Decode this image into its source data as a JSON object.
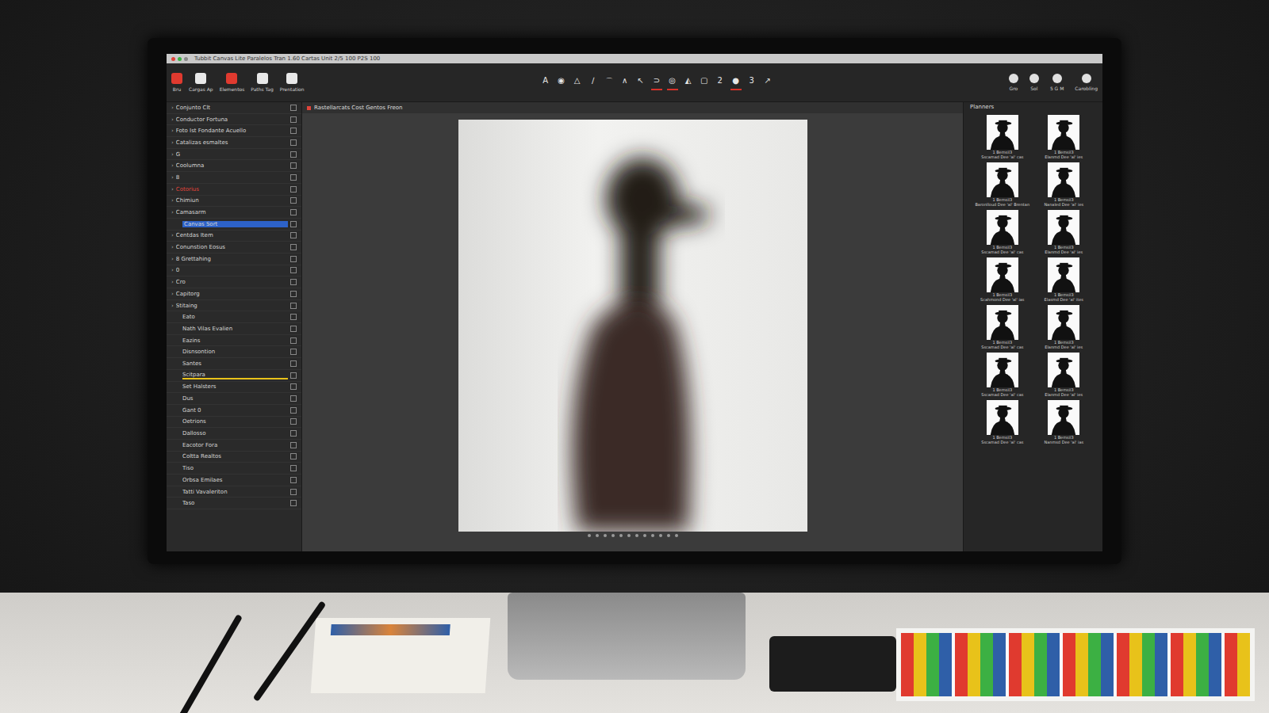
{
  "window": {
    "title": "Tubbit Canvas Lite  Paralelos  Tran  1.60  Cartas Unit  2/5  100  P2S  100"
  },
  "app_toolbar": [
    {
      "label": "Bru"
    },
    {
      "label": "Cargas Ap"
    },
    {
      "label": "Elementos"
    },
    {
      "label": "Paths Tag"
    },
    {
      "label": "Prentation"
    }
  ],
  "tools": [
    {
      "glyph": "A",
      "selected": false
    },
    {
      "glyph": "◉",
      "selected": false
    },
    {
      "glyph": "△",
      "selected": false
    },
    {
      "glyph": "∕",
      "selected": false
    },
    {
      "glyph": "⌒",
      "selected": false
    },
    {
      "glyph": "∧",
      "selected": false
    },
    {
      "glyph": "↖",
      "selected": false
    },
    {
      "glyph": "⊃",
      "selected": true
    },
    {
      "glyph": "◎",
      "selected": true
    },
    {
      "glyph": "◭",
      "selected": false
    },
    {
      "glyph": "▢",
      "selected": false
    },
    {
      "glyph": "2",
      "selected": false
    },
    {
      "glyph": "●",
      "selected": true
    },
    {
      "glyph": "3",
      "selected": false
    },
    {
      "glyph": "↗",
      "selected": false
    }
  ],
  "right_tools": [
    {
      "label": "Gro"
    },
    {
      "label": "Sol"
    },
    {
      "label": "5 G M"
    },
    {
      "label": "Carobling"
    }
  ],
  "document_tab": "Rastellarcats  Cost Gentos  Freon",
  "panel_title": "Planners",
  "layers": [
    {
      "kind": "group",
      "toggle": "›",
      "label": "Conjunto Clt",
      "selected": false,
      "alert": false
    },
    {
      "kind": "group",
      "toggle": "›",
      "label": "Conductor Fortuna",
      "selected": false,
      "alert": false
    },
    {
      "kind": "group",
      "toggle": "›",
      "label": "Foto Ist Fondante Acuello",
      "selected": false,
      "alert": false
    },
    {
      "kind": "group",
      "toggle": "›",
      "label": "Catalizas esmaltes",
      "selected": false,
      "alert": false
    },
    {
      "kind": "group",
      "toggle": "›",
      "label": "G",
      "selected": false,
      "alert": false
    },
    {
      "kind": "group",
      "toggle": "›",
      "label": "Coolumna",
      "selected": false,
      "alert": false
    },
    {
      "kind": "group",
      "toggle": "›",
      "label": "8",
      "selected": false,
      "alert": false
    },
    {
      "kind": "group",
      "toggle": "›",
      "label": "Cotorius",
      "selected": false,
      "alert": true
    },
    {
      "kind": "group",
      "toggle": "›",
      "label": "Chimiun",
      "selected": false,
      "alert": false
    },
    {
      "kind": "group",
      "toggle": "›",
      "label": "Camasarm",
      "selected": false,
      "alert": false
    },
    {
      "kind": "item",
      "toggle": "",
      "label": "Canvas Sort",
      "selected": true,
      "alert": false
    },
    {
      "kind": "group",
      "toggle": "›",
      "label": "Centdas Item",
      "selected": false,
      "alert": false
    },
    {
      "kind": "group",
      "toggle": "›",
      "label": "Conunstion Eosus",
      "selected": false,
      "alert": false
    },
    {
      "kind": "group",
      "toggle": "›",
      "label": "8 Grettahing",
      "selected": false,
      "alert": false
    },
    {
      "kind": "group",
      "toggle": "›",
      "label": "0",
      "selected": false,
      "alert": false
    },
    {
      "kind": "group",
      "toggle": "›",
      "label": "Cro",
      "selected": false,
      "alert": false
    },
    {
      "kind": "group",
      "toggle": "›",
      "label": "Capitorg",
      "selected": false,
      "alert": false
    },
    {
      "kind": "group",
      "toggle": "›",
      "label": "Stitaing",
      "selected": false,
      "alert": false
    },
    {
      "kind": "item",
      "toggle": "",
      "label": "Eato",
      "selected": false,
      "alert": false
    },
    {
      "kind": "item",
      "toggle": "",
      "label": "Nath Vilas Evalien",
      "selected": false,
      "alert": false
    },
    {
      "kind": "item",
      "toggle": "",
      "label": "Eazins",
      "selected": false,
      "alert": false
    },
    {
      "kind": "item",
      "toggle": "",
      "label": "Disnsontion",
      "selected": false,
      "alert": false
    },
    {
      "kind": "item",
      "toggle": "",
      "label": "Santes",
      "selected": false,
      "alert": false
    },
    {
      "kind": "item",
      "toggle": "",
      "label": "Scitpara",
      "selected": true,
      "alert": false
    },
    {
      "kind": "item",
      "toggle": "",
      "label": "Set Halsters",
      "selected": false,
      "alert": false
    },
    {
      "kind": "item",
      "toggle": "",
      "label": "Dus",
      "selected": false,
      "alert": false
    },
    {
      "kind": "item",
      "toggle": "",
      "label": "Gant 0",
      "selected": false,
      "alert": false
    },
    {
      "kind": "item",
      "toggle": "",
      "label": "Oetrions",
      "selected": false,
      "alert": false
    },
    {
      "kind": "item",
      "toggle": "",
      "label": "Dallosso",
      "selected": false,
      "alert": false
    },
    {
      "kind": "item",
      "toggle": "",
      "label": "Eacotor Fora",
      "selected": false,
      "alert": false
    },
    {
      "kind": "item",
      "toggle": "",
      "label": "Coltta Realtos",
      "selected": false,
      "alert": false
    },
    {
      "kind": "item",
      "toggle": "",
      "label": "Tiso",
      "selected": false,
      "alert": false
    },
    {
      "kind": "item",
      "toggle": "",
      "label": "Orbsa Emilaes",
      "selected": false,
      "alert": false
    },
    {
      "kind": "item",
      "toggle": "",
      "label": "Tatti Vavaleriton",
      "selected": false,
      "alert": false
    },
    {
      "kind": "item",
      "toggle": "",
      "label": "Taso",
      "selected": false,
      "alert": false
    }
  ],
  "thumbnails": [
    {
      "name": "1 Bemsil3",
      "caption": "Sscamad Dee 'al' cas"
    },
    {
      "name": "1 Bemsil3",
      "caption": "Elanmd Dee 'al' ies"
    },
    {
      "name": "1 Bemsil3",
      "caption": "Baronlloud Dee 'al' Brentan"
    },
    {
      "name": "1 Bemsil3",
      "caption": "Nanaled Dee 'al' ies"
    },
    {
      "name": "1 Bemsil3",
      "caption": "Sscamad Dee 'al' cas"
    },
    {
      "name": "1 Bemsil3",
      "caption": "Elanmd Dee 'al' ies"
    },
    {
      "name": "1 Bemsil3",
      "caption": "Scahmond Dee 'al' ias"
    },
    {
      "name": "1 Bemsil3",
      "caption": "Elasmd Dee 'al' ites"
    },
    {
      "name": "1 Bemsil3",
      "caption": "Sscamad Dee 'al' cas"
    },
    {
      "name": "1 Bemsil3",
      "caption": "Elanmd Dee 'al' ies"
    },
    {
      "name": "1 Bemsil3",
      "caption": "Sscamad Dee 'al' cas"
    },
    {
      "name": "1 Bemsil3",
      "caption": "Elanmd Dee 'al' ies"
    },
    {
      "name": "1 Bemsil3",
      "caption": "Sscamad Dee 'al' cas"
    },
    {
      "name": "1 Bemsil3",
      "caption": "Nanmsd Dee 'al' ias"
    }
  ]
}
